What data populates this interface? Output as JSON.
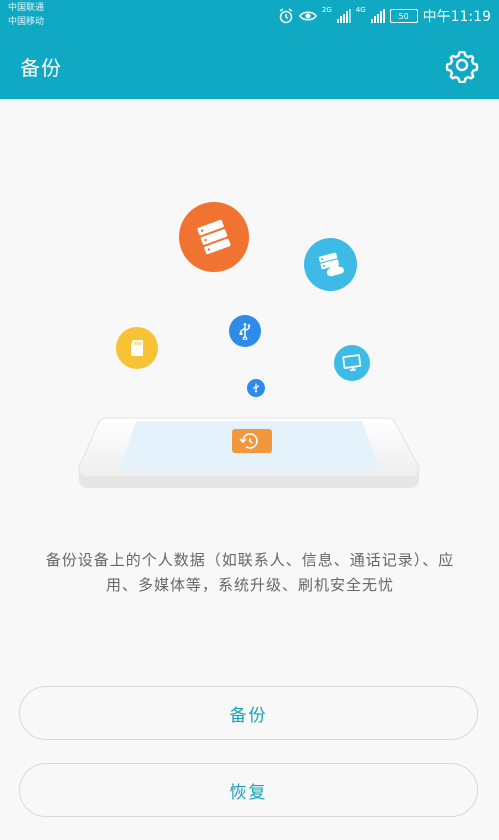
{
  "status_bar": {
    "carrier_1": "中国联通",
    "carrier_2": "中国移动",
    "net_1": "2G",
    "net_2": "4G",
    "battery": "50",
    "time": "中午11:19"
  },
  "app_bar": {
    "title": "备份",
    "settings_icon": "gear-icon"
  },
  "illustration": {
    "icons": [
      "server-icon",
      "cloud-server-icon",
      "usb-icon",
      "sd-card-icon",
      "monitor-icon",
      "usb-small-icon",
      "phone-backup-icon"
    ],
    "colors": {
      "orange": "#f07332",
      "blue": "#3dbbe6",
      "yellow": "#f7c334",
      "dark_blue": "#2f8be8",
      "teal": "#10a9c3"
    }
  },
  "description": "备份设备上的个人数据（如联系人、信息、通话记录）、应用、多媒体等，系统升级、刷机安全无忧",
  "buttons": {
    "backup": "备份",
    "restore": "恢复"
  }
}
